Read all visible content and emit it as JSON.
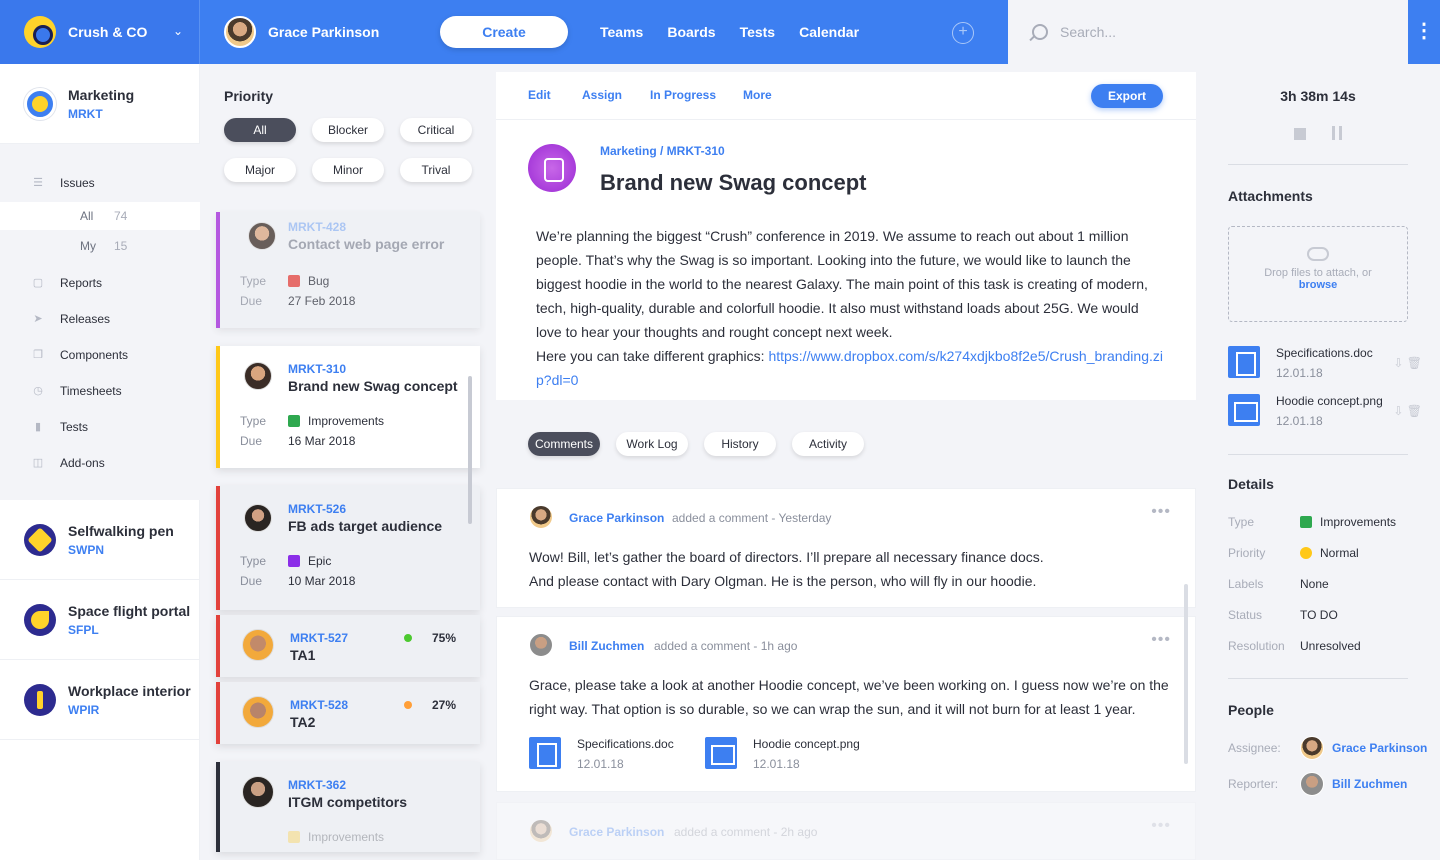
{
  "app": {
    "org": "Crush & CO",
    "user": "Grace Parkinson",
    "create": "Create",
    "nav": [
      "Teams",
      "Boards",
      "Tests",
      "Calendar"
    ],
    "search_placeholder": "Search..."
  },
  "sidebar": {
    "projects": [
      {
        "name": "Marketing",
        "key": "MRKT"
      },
      {
        "name": "Selfwalking pen",
        "key": "SWPN"
      },
      {
        "name": "Space flight portal",
        "key": "SFPL"
      },
      {
        "name": "Workplace interior",
        "key": "WPIR"
      }
    ],
    "menu": [
      "Issues",
      "Reports",
      "Releases",
      "Components",
      "Timesheets",
      "Tests",
      "Add-ons"
    ],
    "sub": [
      {
        "label": "All",
        "count": "74"
      },
      {
        "label": "My",
        "count": "15"
      }
    ]
  },
  "priority": {
    "title": "Priority",
    "chips": [
      "All",
      "Blocker",
      "Critical",
      "Major",
      "Minor",
      "Trival"
    ]
  },
  "cards": [
    {
      "key": "MRKT-428",
      "title": "Contact web page error",
      "type_label": "Type",
      "type": "Bug",
      "due_label": "Due",
      "due": "27 Feb 2018",
      "color": "#a024d8"
    },
    {
      "key": "MRKT-310",
      "title": "Brand new Swag concept",
      "type_label": "Type",
      "type": "Improvements",
      "due_label": "Due",
      "due": "16 Mar 2018",
      "color": "#ffc818"
    },
    {
      "key": "MRKT-526",
      "title": "FB ads target audience",
      "type_label": "Type",
      "type": "Epic",
      "due_label": "Due",
      "due": "10 Mar 2018",
      "color": "#e2413b"
    },
    {
      "key": "MRKT-527",
      "title": "TA1",
      "pct": "75%",
      "color": "#e2413b"
    },
    {
      "key": "MRKT-528",
      "title": "TA2",
      "pct": "27%",
      "color": "#e2413b"
    },
    {
      "key": "MRKT-362",
      "title": "ITGM competitors",
      "type": "Improvements",
      "color": "#2c2f3a"
    }
  ],
  "issue": {
    "actions": [
      "Edit",
      "Assign",
      "In Progress",
      "More"
    ],
    "export": "Export",
    "breadcrumb": "Marketing / MRKT-310",
    "title": "Brand new Swag concept",
    "description": "We’re planning the biggest “Crush” conference in 2019. We assume to reach out about 1 million people. That’s why the Swag is so important. Looking into the future, we would like to launch the biggest hoodie in the world to the nearest Galaxy. The main point of this task is creating of modern, tech, high-quality, durable and colorfull hoodie. It also must withstand loads about 25G. We would love to hear your thoughts and rought concept next week.",
    "graphics_prefix": "Here you can take different graphics: ",
    "link": "https://www.dropbox.com/s/k274xdjkbo8f2e5/Crush_branding.zip?dl=0"
  },
  "comment_tabs": [
    "Comments",
    "Work Log",
    "History",
    "Activity"
  ],
  "comments": [
    {
      "author": "Grace Parkinson",
      "action": "added a comment - Yesterday",
      "text1": "Wow! Bill, let’s gather the board of directors. I’ll prepare all necessary finance docs.",
      "text2": "And please contact with Dary Olgman. He is the person, who will fly in our hoodie."
    },
    {
      "author": "Bill Zuchmen",
      "action": "added a comment - 1h ago",
      "text1": "Grace, please take a look at another Hoodie concept, we’ve been working on. I guess now we’re on the right way. That option is so durable, so we can wrap the sun, and it will not burn for at least 1 year.",
      "files": [
        {
          "name": "Specifications.doc",
          "date": "12.01.18"
        },
        {
          "name": "Hoodie concept.png",
          "date": "12.01.18"
        }
      ]
    },
    {
      "author": "Grace Parkinson",
      "action": "added a comment - 2h ago"
    }
  ],
  "right": {
    "timer": "3h 38m 14s",
    "attachments_title": "Attachments",
    "drop_text": "Drop files to attach, or",
    "browse": "browse",
    "files": [
      {
        "name": "Specifications.doc",
        "date": "12.01.18"
      },
      {
        "name": "Hoodie concept.png",
        "date": "12.01.18"
      }
    ],
    "details_title": "Details",
    "details": [
      {
        "label": "Type",
        "value": "Improvements"
      },
      {
        "label": "Priority",
        "value": "Normal"
      },
      {
        "label": "Labels",
        "value": "None"
      },
      {
        "label": "Status",
        "value": "TO DO"
      },
      {
        "label": "Resolution",
        "value": "Unresolved"
      }
    ],
    "people_title": "People",
    "people": [
      {
        "label": "Assignee:",
        "name": "Grace Parkinson"
      },
      {
        "label": "Reporter:",
        "name": "Bill Zuchmen"
      }
    ]
  },
  "colors": {
    "accent": "#3d7ff1",
    "improvement": "#2ea84f",
    "bug": "#e2413b",
    "epic": "#8b2ee8",
    "normal": "#ffc818",
    "green_dot": "#4cc92f",
    "orange_dot": "#ff9f38"
  }
}
